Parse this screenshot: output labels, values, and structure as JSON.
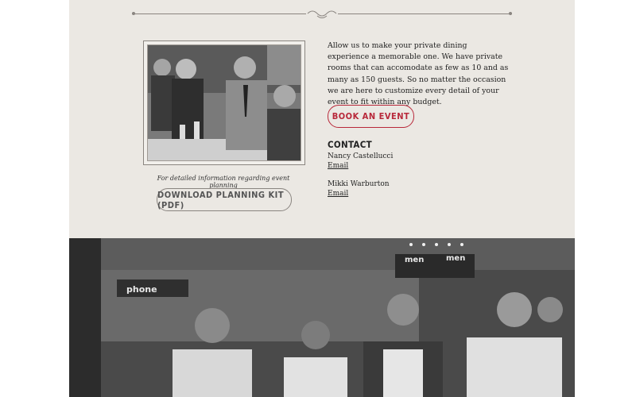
{
  "intro": {
    "text": "Allow us to make your private dining experience a memorable one. We have private rooms that can accomodate as few as 10 and as many as 150 guests. So no matter the occasion we are here to customize every detail of your event to fit within any budget."
  },
  "book_button": {
    "label": "BOOK AN EVENT"
  },
  "contact": {
    "heading": "CONTACT",
    "people": [
      {
        "name": "Nancy Castellucci",
        "link": "Email"
      },
      {
        "name": "Mikki Warburton",
        "link": "Email"
      }
    ]
  },
  "planning": {
    "caption": "For detailed information regarding event planning",
    "download_label": "DOWNLOAD PLANNING KIT (PDF)"
  },
  "bottom_photo": {
    "sign_text": "phone",
    "sign_text_2": "men",
    "sign_text_3": "men"
  },
  "colors": {
    "panel_bg": "#ebe8e3",
    "accent_red": "#b8283a",
    "text": "#222222",
    "line": "#8a8580"
  },
  "icons": [
    "divider-ornament-icon"
  ]
}
